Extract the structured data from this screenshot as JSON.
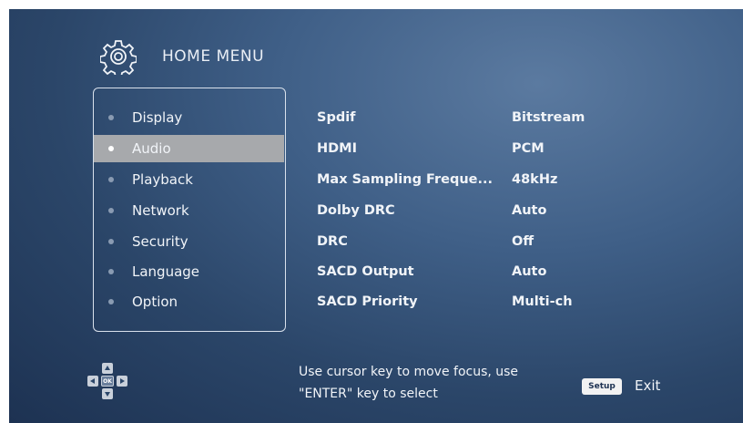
{
  "header": {
    "title": "HOME MENU",
    "icon": "gear-icon"
  },
  "menu": {
    "items": [
      {
        "label": "Display"
      },
      {
        "label": "Audio",
        "selected": true
      },
      {
        "label": "Playback"
      },
      {
        "label": "Network"
      },
      {
        "label": "Security"
      },
      {
        "label": "Language"
      },
      {
        "label": "Option"
      }
    ]
  },
  "settings": [
    {
      "name": "Spdif",
      "value": "Bitstream"
    },
    {
      "name": "HDMI",
      "value": "PCM"
    },
    {
      "name": "Max Sampling Freque...",
      "value": "48kHz"
    },
    {
      "name": "Dolby DRC",
      "value": "Auto"
    },
    {
      "name": "DRC",
      "value": "Off"
    },
    {
      "name": "SACD Output",
      "value": "Auto"
    },
    {
      "name": "SACD Priority",
      "value": "Multi-ch"
    }
  ],
  "footer": {
    "dpad_ok": "OK",
    "help_line1": "Use cursor key to move focus, use",
    "help_line2": "\"ENTER\" key to select",
    "setup_key": "Setup",
    "exit_label": "Exit"
  },
  "colors": {
    "background": "#2b4669",
    "selected_highlight": "#a7a9ac",
    "text": "#f1f4f8"
  }
}
